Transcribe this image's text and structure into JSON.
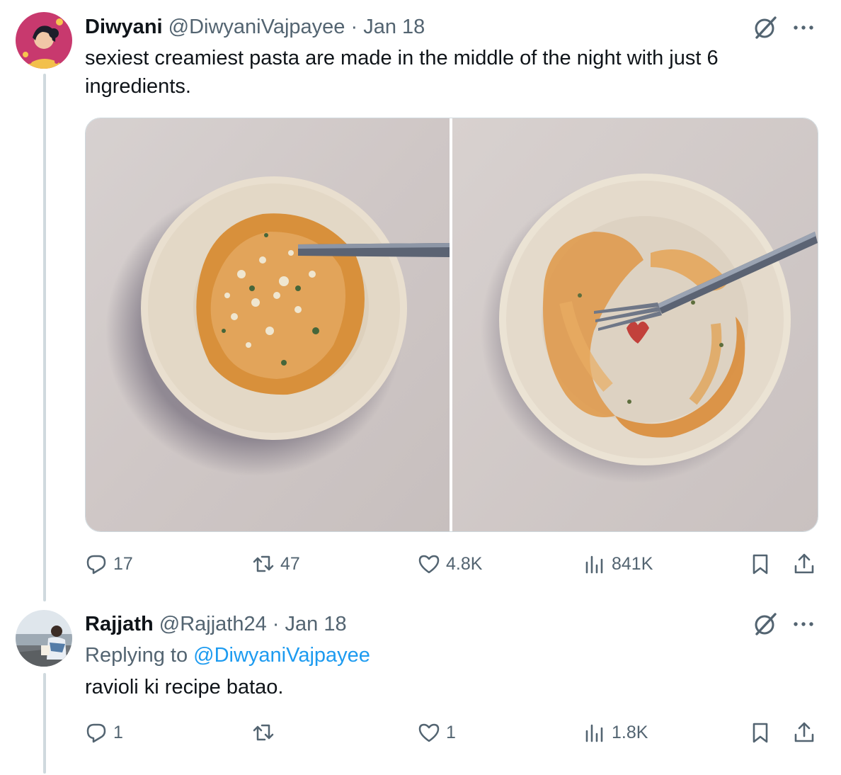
{
  "colors": {
    "text": "#0f1419",
    "muted": "#536471",
    "link": "#1d9bf0",
    "line": "#cfd9de",
    "heart": "#c2413b"
  },
  "tweet1": {
    "name": "Diwyani",
    "handle": "@DiwyaniVajpayee",
    "sep": "·",
    "date": "Jan 18",
    "text_line1": "sexiest creamiest pasta are made in the middle of the night with just 6",
    "text_line2": "ingredients.",
    "icons": {
      "grok": "grok-icon",
      "more": "more-icon"
    },
    "actions": {
      "replies": "17",
      "reposts": "47",
      "likes": "4.8K",
      "views": "841K"
    }
  },
  "tweet2": {
    "name": "Rajjath",
    "handle": "@Rajjath24",
    "sep": "·",
    "date": "Jan 18",
    "replying_prefix": "Replying to",
    "replying_handle": "@DiwyaniVajpayee",
    "text": "ravioli ki recipe batao.",
    "actions": {
      "replies": "1",
      "reposts": "",
      "likes": "1",
      "views": "1.8K"
    }
  }
}
